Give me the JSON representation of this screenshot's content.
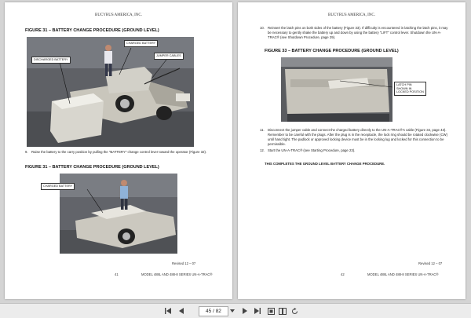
{
  "left_page": {
    "header": "BUCYRUS AMERICA, INC.",
    "figure1_title": "FIGURE 31 – BATTERY CHANGE PROCEDURE (GROUND LEVEL)",
    "figure1_callouts": [
      "DISCHARGED BATTERY",
      "CHARGED BATTERY",
      "JUMPER CABLES"
    ],
    "step9_num": "9.",
    "step9_text": "Raise the battery to the carry position by pulling the \"BATTERY\" change control lever toward the operator (Figure 32).",
    "figure2_title": "FIGURE 31 – BATTERY CHANGE PROCEDURE (GROUND LEVEL)",
    "figure2_callouts": [
      "CHARGED BATTERY"
    ],
    "page_number": "41",
    "revised": "Revised 12 – 07",
    "model": "MODEL 488L AND 488-8 SERIES UN-A-TRAC®"
  },
  "right_page": {
    "header": "BUCYRUS AMERICA, INC.",
    "step10_num": "10.",
    "step10_text": "Reinsert the latch pins on both sides of the battery (Figure 33). If difficulty is encountered in latching the latch pins, it may be necessary to gently shake the battery up and down by using the battery \"LIFT\" control lever. Shutdown the UN-A-TRAC® (see Shutdown Procedure, page 29).",
    "figure_title": "FIGURE 33 – BATTERY CHANGE PROCEDURE (GROUND LEVEL)",
    "callout": [
      "LATCH PIN",
      "SHOWN IN",
      "LOCKED POSITION"
    ],
    "step11_num": "11.",
    "step11_text": "Disconnect the jumper cable and connect the charged battery directly to the UN-A-TRAC®'s cable (Figure 34, page 43). Remember to be careful with the plugs. After the plug is in the receptacle, the lock ring should be rotated clockwise (CW) until hand tight. The padlock or approved locking device must be in the locking lug and locked for this connection to be permissible.",
    "step12_num": "12.",
    "step12_text": "Start the UN-A-TRAC® (see Starting Procedure, page 23).",
    "completion_text": "THIS COMPLETES THE GROUND LEVEL BATTERY CHANGE PROCEDURE.",
    "page_number": "42",
    "revised": "Revised 12 – 07",
    "model": "MODEL 488L AND 488-8 SERIES UN-A-TRAC®"
  },
  "toolbar": {
    "page_field": "45 / 82",
    "first_icon": "first-page-icon",
    "prev_icon": "prev-page-icon",
    "next_icon": "next-page-icon",
    "last_icon": "last-page-icon"
  }
}
